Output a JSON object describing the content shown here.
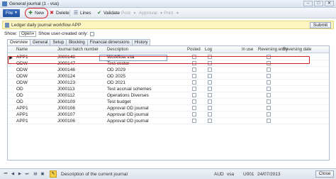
{
  "window": {
    "title": "General journal (1 - vsa)",
    "min": "–",
    "max": "□",
    "close": "✕"
  },
  "toolbar": {
    "file": "File",
    "new": "New",
    "delete": "Delete",
    "lines": "Lines",
    "validate": "Validate",
    "post": "Post",
    "approval": "Approval",
    "print": "Print"
  },
  "banner": {
    "text": "Ledger daily journal workflow APP",
    "submit": "Submit"
  },
  "filter": {
    "show_label": "Show:",
    "show_value": "Open",
    "user_created_label": "Show user-created only:"
  },
  "tabs": [
    "Overview",
    "General",
    "Setup",
    "Blocking",
    "Financial dimensions",
    "History"
  ],
  "grid": {
    "columns": [
      "Name",
      "Journal batch number",
      "Description",
      "Posted",
      "Log",
      "In use",
      "Reversing entry",
      "Reversing date"
    ],
    "rows": [
      {
        "name": "APP1",
        "batch": "J000148",
        "desc": "Workflow vsa"
      },
      {
        "name": "ODW",
        "batch": "J000147",
        "desc": "Test vector"
      },
      {
        "name": "ODW",
        "batch": "J000146",
        "desc": "OD 2029"
      },
      {
        "name": "ODW",
        "batch": "J000124",
        "desc": "OD 2025"
      },
      {
        "name": "ODW",
        "batch": "J000123",
        "desc": "OD 2021"
      },
      {
        "name": "OD",
        "batch": "J000113",
        "desc": "Test accrual schemes"
      },
      {
        "name": "OD",
        "batch": "J000112",
        "desc": "Operations Diverses"
      },
      {
        "name": "OD",
        "batch": "J000109",
        "desc": "Test budget"
      },
      {
        "name": "APP1",
        "batch": "J000108",
        "desc": "Approval OD journal"
      },
      {
        "name": "APP1",
        "batch": "J000107",
        "desc": "Approval OD journal"
      },
      {
        "name": "APP1",
        "batch": "J000106",
        "desc": "Approval OD journal"
      }
    ]
  },
  "statusbar": {
    "description": "Description of the current journal",
    "currency": "AUD",
    "company": "vsa",
    "partition": "U001",
    "date": "24/07/2013",
    "close": "Close"
  },
  "colors": {
    "accent": "#1f4e9e",
    "highlight": "#d21e1e",
    "banner": "#fdf6c3"
  }
}
